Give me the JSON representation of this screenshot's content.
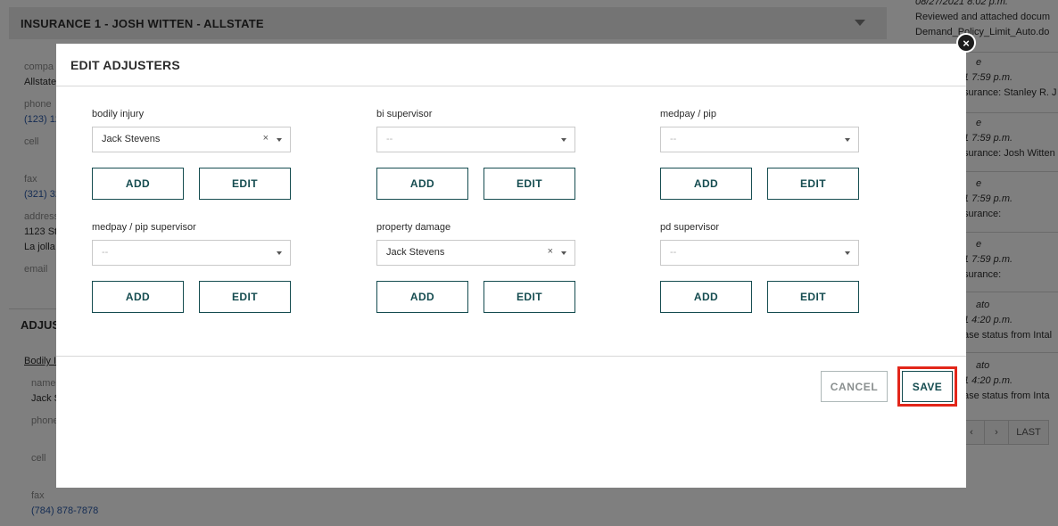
{
  "background": {
    "insurance_header": "INSURANCE 1 - JOSH WITTEN - ALLSTATE",
    "fields": {
      "company_label": "compa",
      "company_value": "Allstate",
      "phone_label": "phone",
      "phone_value": "(123) 12",
      "cell_label": "cell",
      "fax_label": "fax",
      "fax_value": "(321) 32",
      "address_label": "address",
      "address_line1": "1123 St",
      "address_line2": "La jolla",
      "email_label": "email"
    },
    "adjusters_section": {
      "title": "ADJUS",
      "link": "Bodily I",
      "name_label": "name",
      "name_value": "Jack S",
      "phone_label": "phone",
      "cell_label": "cell",
      "fax_label": "fax",
      "fax_value": "(784) 878-7878"
    },
    "activity": [
      {
        "date": "08/27/2021 8:02 p.m.",
        "text1": "Reviewed and attached docum",
        "text2": "Demand_Policy_Limit_Auto.do"
      },
      {
        "name": "e",
        "date": "1 7:59 p.m.",
        "text1": "surance: Stanley R. J"
      },
      {
        "name": "e",
        "date": "1 7:59 p.m.",
        "text1": "surance: Josh Witten"
      },
      {
        "name": "e",
        "date": "1 7:59 p.m.",
        "text1": "surance:"
      },
      {
        "name": "e",
        "date": "1 7:59 p.m.",
        "text1": "surance:"
      },
      {
        "name": "ato",
        "date": "1 4:20 p.m.",
        "text1": "ase status from Intal"
      },
      {
        "name": "ato",
        "date": "1 4:20 p.m.",
        "text1": "ase status from Inta"
      }
    ],
    "pager": {
      "prev": "‹",
      "next": "›",
      "last": "LAST"
    }
  },
  "modal": {
    "title": "EDIT ADJUSTERS",
    "close_glyph": "×",
    "fields": [
      {
        "label": "bodily injury",
        "value": "Jack Stevens",
        "placeholder": "",
        "clear": "×"
      },
      {
        "label": "bi supervisor",
        "value": "",
        "placeholder": "--",
        "clear": ""
      },
      {
        "label": "medpay / pip",
        "value": "",
        "placeholder": "--",
        "clear": ""
      },
      {
        "label": "medpay / pip supervisor",
        "value": "",
        "placeholder": "--",
        "clear": ""
      },
      {
        "label": "property damage",
        "value": "Jack Stevens",
        "placeholder": "",
        "clear": "×"
      },
      {
        "label": "pd supervisor",
        "value": "",
        "placeholder": "--",
        "clear": ""
      }
    ],
    "add_label": "ADD",
    "edit_label": "EDIT",
    "cancel_label": "CANCEL",
    "save_label": "SAVE"
  },
  "colors": {
    "accent": "#154c50",
    "highlight": "#e2261a",
    "overlay": "#000000"
  }
}
